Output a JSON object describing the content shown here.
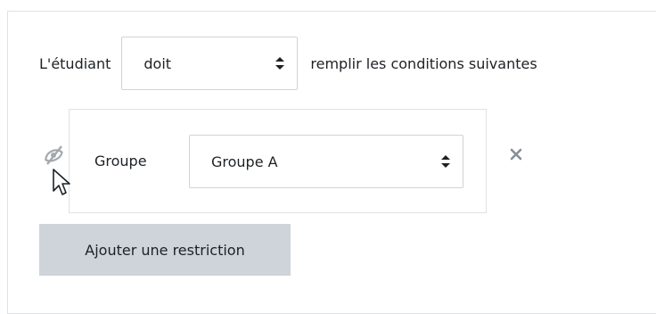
{
  "restriction": {
    "prefix_label": "L'étudiant",
    "must_select": {
      "value": "doit"
    },
    "suffix_label": "remplir les conditions suivantes"
  },
  "condition": {
    "type_label": "Groupe",
    "group_select": {
      "value": "Groupe A"
    },
    "visibility_icon": "eye-slash-icon",
    "remove_icon": "close-icon"
  },
  "add_button": {
    "label": "Ajouter une restriction"
  },
  "colors": {
    "border": "#dee2e6",
    "select_border": "#ced4da",
    "button_bg": "#ced4da",
    "icon_gray": "#868e96",
    "text": "#1d2125"
  }
}
